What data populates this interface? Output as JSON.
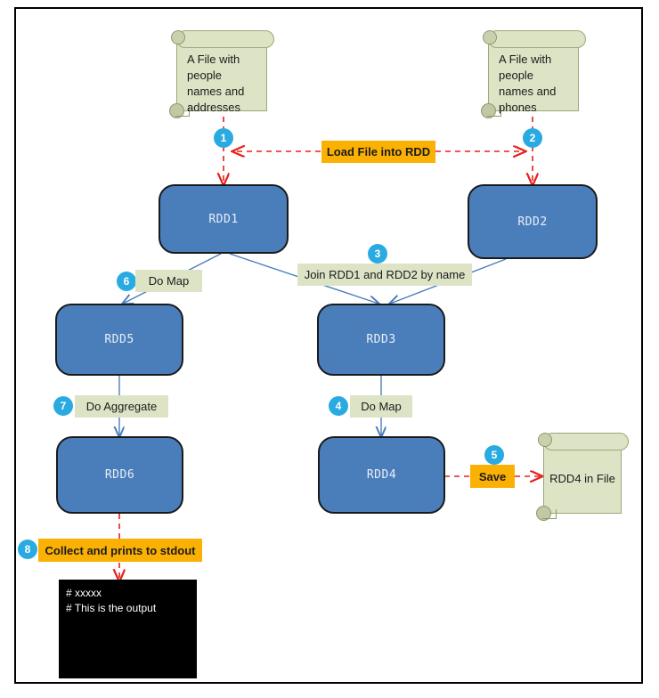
{
  "diagram": {
    "title": "Spark RDD data flow diagram",
    "colors": {
      "rdd_fill": "#4A7EBB",
      "scroll_fill": "#DDE4C6",
      "label_green": "#DDE4C6",
      "label_orange": "#FBB004",
      "badge": "#29ABE2",
      "flow_line": "#4A7EBB",
      "dashed_line": "#E8201C",
      "terminal_bg": "#000000",
      "frame_border": "#000000"
    }
  },
  "sources": {
    "file1": {
      "lines": [
        "A File with",
        "people",
        "names and",
        "addresses"
      ]
    },
    "file2": {
      "lines": [
        "A File with",
        "people",
        "names and",
        "phones"
      ]
    },
    "output_file": {
      "label": "RDD4 in File"
    }
  },
  "rdds": [
    {
      "id": "rdd1",
      "label": "RDD1"
    },
    {
      "id": "rdd2",
      "label": "RDD2"
    },
    {
      "id": "rdd3",
      "label": "RDD3"
    },
    {
      "id": "rdd4",
      "label": "RDD4"
    },
    {
      "id": "rdd5",
      "label": "RDD5"
    },
    {
      "id": "rdd6",
      "label": "RDD6"
    }
  ],
  "operations": [
    {
      "step": "1",
      "label": "Load File into RDD",
      "style": "orange"
    },
    {
      "step": "2",
      "label": "Load File into RDD",
      "style": "orange"
    },
    {
      "step": "3",
      "label": "Join RDD1 and RDD2 by name",
      "style": "green"
    },
    {
      "step": "4",
      "label": "Do Map",
      "style": "green"
    },
    {
      "step": "5",
      "label": "Save",
      "style": "orange"
    },
    {
      "step": "6",
      "label": "Do Map",
      "style": "green"
    },
    {
      "step": "7",
      "label": "Do Aggregate",
      "style": "green"
    },
    {
      "step": "8",
      "label": "Collect and prints to stdout",
      "style": "orange"
    }
  ],
  "badges": {
    "b1": "1",
    "b2": "2",
    "b3": "3",
    "b4": "4",
    "b5": "5",
    "b6": "6",
    "b7": "7",
    "b8": "8"
  },
  "labels": {
    "load_file": "Load File into RDD",
    "join": "Join RDD1 and RDD2 by name",
    "do_map_right": "Do Map",
    "do_map_left": "Do Map",
    "do_aggregate": "Do Aggregate",
    "save": "Save",
    "collect": "Collect and prints to stdout"
  },
  "terminal": {
    "lines": [
      "# xxxxx",
      "# This is the output"
    ]
  }
}
